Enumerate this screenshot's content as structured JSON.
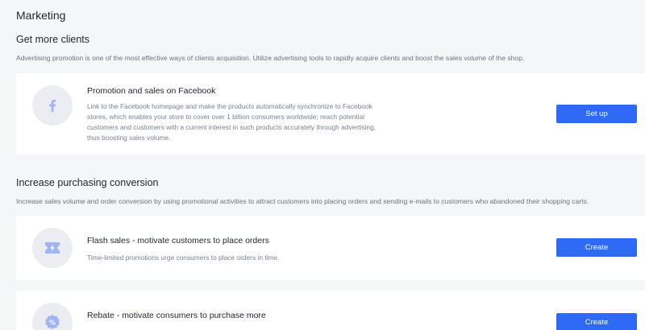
{
  "page_title": "Marketing",
  "sections": [
    {
      "title": "Get more clients",
      "description": "Advertising promotion is one of the most effective ways of clients acquisition. Utilize advertising tools to rapidly acquire clients and boost the sales volume of the shop.",
      "cards": [
        {
          "icon": "facebook-icon",
          "title": "Promotion and sales on Facebook",
          "description_lines": [
            "Link to the Facebook homepage and make the products automatically synchronize to Facebook",
            "stores, which enables your store to cover over 1 billion consumers worldwide; reach potential",
            "customers and customers with a current interest in such products accurately through advertising,",
            "thus boosting sales volume."
          ],
          "button_label": "Set up"
        }
      ]
    },
    {
      "title": "Increase purchasing conversion",
      "description": "Increase sales volume and order conversion by using promotional activities to attract customers into placing orders and sending e-mails to customers who abandoned their shopping carts.",
      "cards": [
        {
          "icon": "flash-sale-ticket-icon",
          "title": "Flash sales - motivate customers to place orders",
          "description_lines": [
            "Time-limited promotions urge consumers to place orders in time."
          ],
          "button_label": "Create"
        },
        {
          "icon": "percent-badge-icon",
          "title": "Rebate - motivate consumers to purchase more",
          "description_lines": [],
          "button_label": "Create"
        }
      ]
    }
  ],
  "colors": {
    "background": "#f5f6f8",
    "card": "#ffffff",
    "primary_button": "#2e6af6",
    "icon_fill": "#9fb4f2",
    "icon_circle": "#ebedf3"
  }
}
